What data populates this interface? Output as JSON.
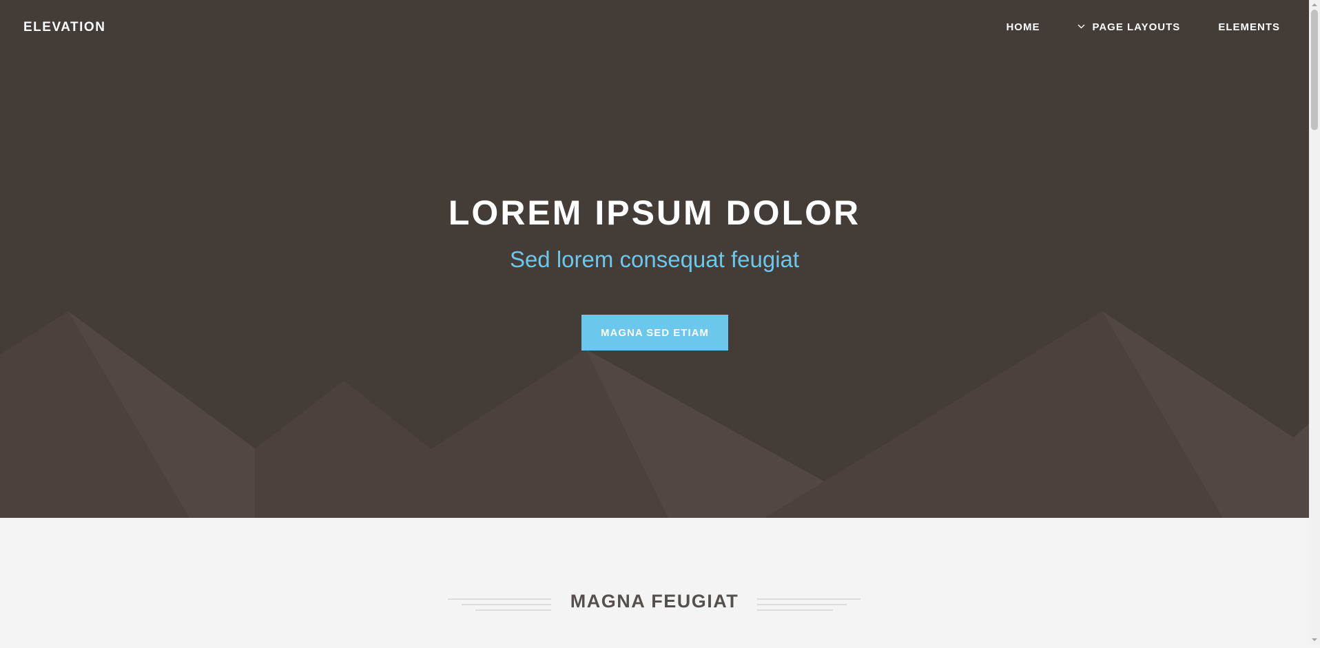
{
  "header": {
    "logo": "ELEVATION",
    "nav": [
      {
        "label": "HOME"
      },
      {
        "label": "PAGE LAYOUTS",
        "icon": "chevron-down-icon"
      },
      {
        "label": "ELEMENTS"
      }
    ]
  },
  "hero": {
    "title": "LOREM IPSUM DOLOR",
    "subtitle": "Sed lorem consequat feugiat",
    "button_label": "MAGNA SED ETIAM"
  },
  "section": {
    "title": "MAGNA FEUGIAT"
  },
  "colors": {
    "hero_background": "#443c37",
    "accent": "#6bc8ec",
    "page_background": "#f4f4f4",
    "heading_text": "#55504d"
  }
}
